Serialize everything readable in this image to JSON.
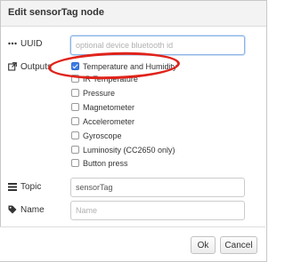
{
  "dialog": {
    "title": "Edit sensorTag node"
  },
  "uuid": {
    "label": "UUID",
    "value": "",
    "placeholder": "optional device bluetooth id"
  },
  "outputs": {
    "label": "Outputs",
    "items": [
      {
        "label": "Temperature and Humidity",
        "checked": true
      },
      {
        "label": "IR Temperature",
        "checked": false
      },
      {
        "label": "Pressure",
        "checked": false
      },
      {
        "label": "Magnetometer",
        "checked": false
      },
      {
        "label": "Accelerometer",
        "checked": false
      },
      {
        "label": "Gyroscope",
        "checked": false
      },
      {
        "label": "Luminosity (CC2650 only)",
        "checked": false
      },
      {
        "label": "Button press",
        "checked": false
      }
    ]
  },
  "topic": {
    "label": "Topic",
    "value": "sensorTag",
    "placeholder": ""
  },
  "name": {
    "label": "Name",
    "value": "",
    "placeholder": "Name"
  },
  "buttons": {
    "ok": "Ok",
    "cancel": "Cancel"
  },
  "colors": {
    "highlight": "#e0231a",
    "checkbox_checked": "#3d7de8"
  }
}
